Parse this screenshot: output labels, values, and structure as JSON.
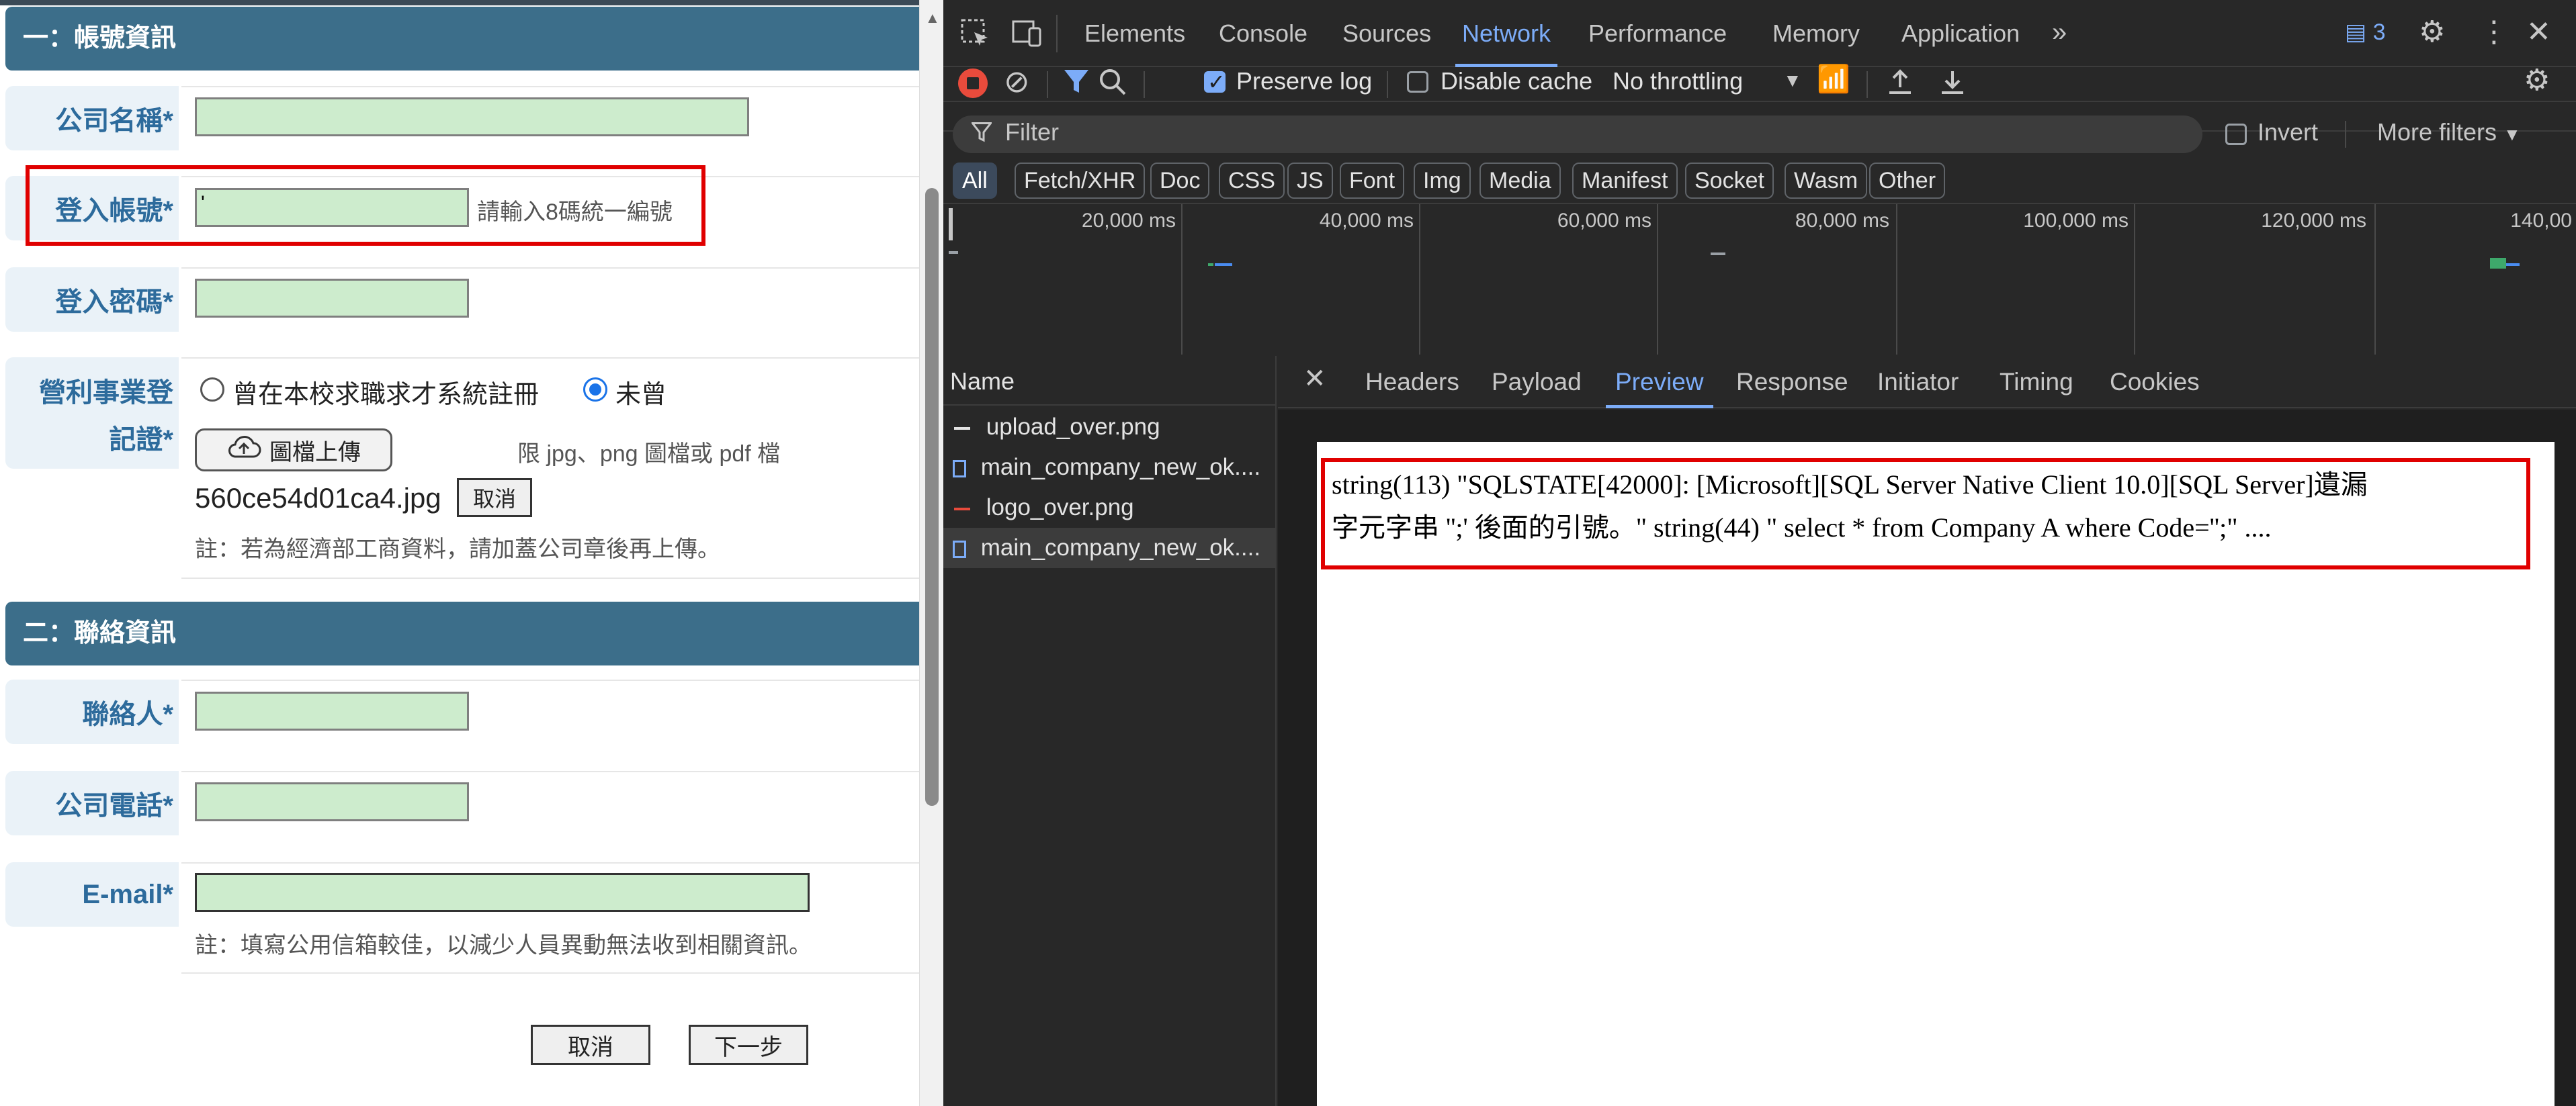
{
  "form": {
    "section1": "一：帳號資訊",
    "section2": "二：聯絡資訊",
    "company_name_label": "公司名稱*",
    "login_account_label": "登入帳號*",
    "login_account_value": "'",
    "login_account_hint": "請輸入8碼統一編號",
    "login_password_label": "登入密碼*",
    "profit_label_line1": "營利事業登",
    "profit_label_line2": "記證*",
    "radio_registered": "曾在本校求職求才系統註冊",
    "radio_never": "未曾",
    "upload_button": "圖檔上傳",
    "upload_hint": "限 jpg、png 圖檔或 pdf 檔",
    "uploaded_file": "560ce54d01ca4.jpg",
    "cancel_file": "取消",
    "upload_note": "註：若為經濟部工商資料，請加蓋公司章後再上傳。",
    "contact_label": "聯絡人*",
    "phone_label": "公司電話*",
    "email_label": "E-mail*",
    "email_note": "註：填寫公用信箱較佳，以減少人員異動無法收到相關資訊。",
    "cancel_button": "取消",
    "next_button": "下一步"
  },
  "devtools": {
    "tabs": [
      "Elements",
      "Console",
      "Sources",
      "Network",
      "Performance",
      "Memory",
      "Application"
    ],
    "active_tab": "Network",
    "issues_count": "3",
    "preserve_log": "Preserve log",
    "disable_cache": "Disable cache",
    "throttling": "No throttling",
    "filter_placeholder": "Filter",
    "invert": "Invert",
    "more_filters": "More filters",
    "chips": [
      "All",
      "Fetch/XHR",
      "Doc",
      "CSS",
      "JS",
      "Font",
      "Img",
      "Media",
      "Manifest",
      "Socket",
      "Wasm",
      "Other"
    ],
    "timeline_ticks": [
      "20,000 ms",
      "40,000 ms",
      "60,000 ms",
      "80,000 ms",
      "100,000 ms",
      "120,000 ms",
      "140,00"
    ],
    "name_header": "Name",
    "requests": [
      {
        "name": "upload_over.png",
        "icon": "image-icon"
      },
      {
        "name": "main_company_new_ok....",
        "icon": "document-icon"
      },
      {
        "name": "logo_over.png",
        "icon": "image-icon"
      },
      {
        "name": "main_company_new_ok....",
        "icon": "document-icon"
      }
    ],
    "detail_tabs": [
      "Headers",
      "Payload",
      "Preview",
      "Response",
      "Initiator",
      "Timing",
      "Cookies"
    ],
    "active_detail_tab": "Preview",
    "preview_line1": "string(113) \"SQLSTATE[42000]: [Microsoft][SQL Server Native Client 10.0][SQL Server]遺漏",
    "preview_line2": "字元字串 '';' 後面的引號。\" string(44) \" select * from Company A where Code='';\" ...."
  },
  "colors": {
    "section_header": "#3c6e8a",
    "label_text": "#2d6b9c",
    "field_bg": "#cdeccd",
    "highlight": "#e00000",
    "devtools_bg": "#282828",
    "devtools_accent": "#7cacf8"
  }
}
